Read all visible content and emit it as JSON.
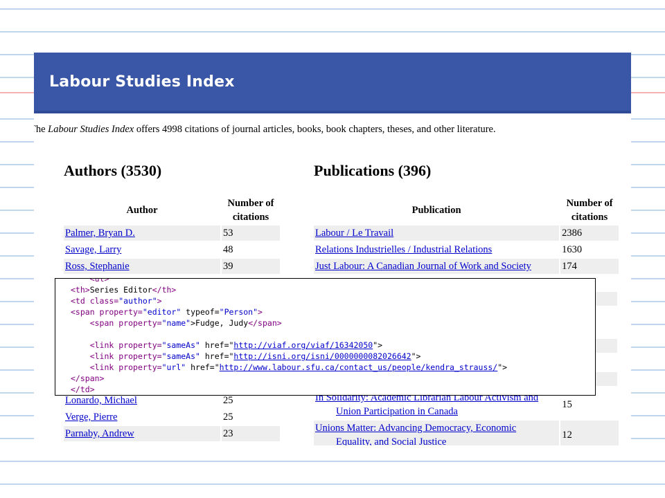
{
  "header": {
    "title": "Labour Studies Index"
  },
  "intro": {
    "prefix": "The ",
    "italic": "Labour Studies Index",
    "suffix": " offers 4998 citations of journal articles, books, book chapters, theses, and other literature."
  },
  "authors": {
    "title": "Authors (3530)",
    "col_author": "Author",
    "col_count_1": "Number of",
    "col_count_2": "citations",
    "rows": [
      {
        "name": "Palmer, Bryan D.",
        "count": "53"
      },
      {
        "name": "Savage, Larry",
        "count": "48"
      },
      {
        "name": "Ross, Stephanie",
        "count": "39"
      },
      {
        "name": "Lonardo, Michael",
        "count": "25"
      },
      {
        "name": "Verge, Pierre",
        "count": "25"
      },
      {
        "name": "Parnaby, Andrew",
        "count": "23"
      }
    ]
  },
  "publications": {
    "title": "Publications (396)",
    "col_pub": "Publication",
    "col_count_1": "Number of",
    "col_count_2": "citations",
    "rows": [
      {
        "name": "Labour / Le Travail",
        "count": "2386"
      },
      {
        "name": "Relations Industrielles / Industrial Relations",
        "count": "1630"
      },
      {
        "name": "Just Labour: A Canadian Journal of Work and Society",
        "count": "174"
      }
    ],
    "bottom_rows": [
      {
        "line1": "In Solidarity: Academic Librarian Labour Activism and",
        "line2": "Union Participation in Canada",
        "count": "15"
      },
      {
        "line1": "Unions Matter: Advancing Democracy, Economic",
        "line2": "Equality, and Social Justice",
        "count": "12"
      }
    ]
  },
  "code": {
    "top_partial": "<ul>",
    "l1_open": "<th>",
    "l1_text": "Series Editor",
    "l1_close": "</th>",
    "l2_tag": "<td class=",
    "l2_val": "\"author\"",
    "l2_end": ">",
    "l3_tag": "<span property=",
    "l3_val1": "\"editor\"",
    "l3_mid": " typeof=",
    "l3_val2": "\"Person\"",
    "l3_end": ">",
    "l4_tag": "<span property=",
    "l4_val": "\"name\"",
    "l4_text": ">Fudge, Judy",
    "l4_close": "</span>",
    "l5_tag": "<link property=",
    "l5_val": "\"sameAs\"",
    "l5_href": " href=\"",
    "l5_url": "http://viaf.org/viaf/16342050",
    "l5_end": "\">",
    "l6_tag": "<link property=",
    "l6_val": "\"sameAs\"",
    "l6_href": " href=\"",
    "l6_url": "http://isni.org/isni/0000000082026642",
    "l6_end": "\">",
    "l7_tag": "<link property=",
    "l7_val": "\"url\"",
    "l7_href": " href=\"",
    "l7_url": "http://www.labour.sfu.ca/contact_us/people/kendra_strauss/",
    "l7_end": "\">",
    "l8": "</span>",
    "l9": "</td>"
  },
  "colors": {
    "header_bg": "#3a56a6",
    "link": "#0000cc",
    "row_shade": "#eeeeee",
    "ruled_line": "#bfd6ee",
    "margin_line": "#f3b3b3"
  }
}
